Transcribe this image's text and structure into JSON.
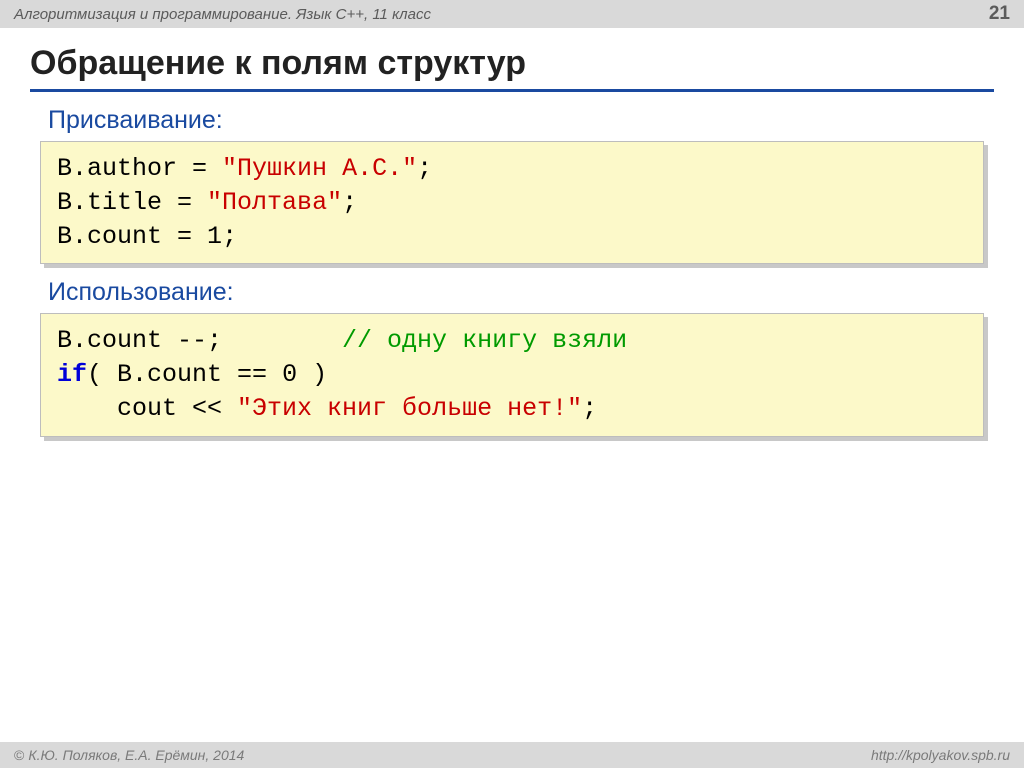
{
  "header": {
    "subject": "Алгоритмизация и программирование. Язык C++, 11 класс",
    "page": "21"
  },
  "title": "Обращение к полям структур",
  "section1_label": "Присваивание:",
  "code1": {
    "l1a": "B.author",
    "l1b": " = ",
    "l1c": "\"Пушкин А.С.\"",
    "l1d": ";",
    "l2a": "B.title",
    "l2b": " = ",
    "l2c": "\"Полтава\"",
    "l2d": ";",
    "l3a": "B.count",
    "l3b": " = ",
    "l3c": "1",
    "l3d": ";"
  },
  "section2_label": "Использование:",
  "code2": {
    "l1a": "B.count --;        ",
    "l1b": "// одну книгу взяли",
    "l2a": "if",
    "l2b": "( B.count == ",
    "l2c": "0",
    "l2d": " )",
    "l3a": "    cout << ",
    "l3b": "\"Этих книг больше нет!\"",
    "l3c": ";"
  },
  "footer": {
    "copyright": "К.Ю. Поляков, Е.А. Ерёмин, 2014",
    "url": "http://kpolyakov.spb.ru"
  }
}
